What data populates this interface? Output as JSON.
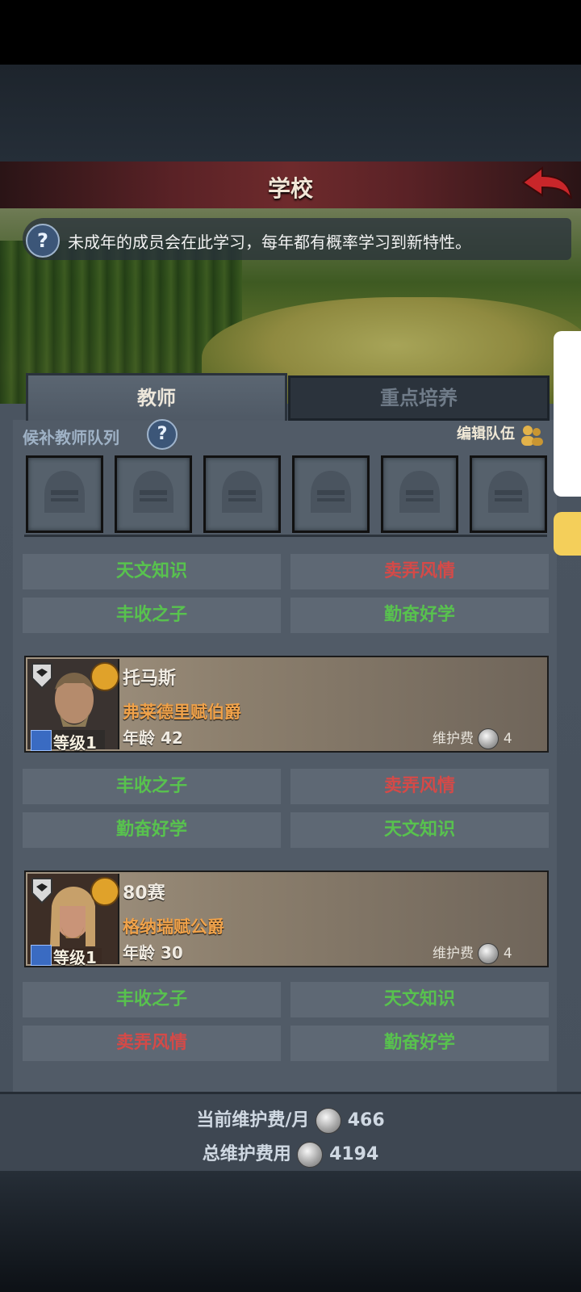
{
  "header": {
    "title": "学校"
  },
  "info": {
    "text": "未成年的成员会在此学习，每年都有概率学习到新特性。"
  },
  "tabs": {
    "teachers": "教师",
    "training": "重点培养"
  },
  "queue": {
    "label": "候补教师队列",
    "edit_team": "编辑队伍",
    "empty_slots": 6
  },
  "queue_traits": [
    {
      "label": "天文知识",
      "tone": "good"
    },
    {
      "label": "卖弄风情",
      "tone": "bad"
    },
    {
      "label": "丰收之子",
      "tone": "good"
    },
    {
      "label": "勤奋好学",
      "tone": "good"
    }
  ],
  "teachers": [
    {
      "name": "托马斯",
      "title": "弗莱德里赋伯爵",
      "age_label": "年龄",
      "age": "42",
      "level": "等级1",
      "upkeep_label": "维护费",
      "upkeep": "4",
      "traits": [
        {
          "label": "丰收之子",
          "tone": "good"
        },
        {
          "label": "卖弄风情",
          "tone": "bad"
        },
        {
          "label": "勤奋好学",
          "tone": "good"
        },
        {
          "label": "天文知识",
          "tone": "good"
        }
      ]
    },
    {
      "name": "80赛",
      "title": "格纳瑞赋公爵",
      "age_label": "年龄",
      "age": "30",
      "level": "等级1",
      "upkeep_label": "维护费",
      "upkeep": "4",
      "traits": [
        {
          "label": "丰收之子",
          "tone": "good"
        },
        {
          "label": "天文知识",
          "tone": "good"
        },
        {
          "label": "卖弄风情",
          "tone": "bad"
        },
        {
          "label": "勤奋好学",
          "tone": "good"
        }
      ]
    }
  ],
  "footer": {
    "monthly_label": "当前维护费/月",
    "monthly_value": "466",
    "total_label": "总维护费用",
    "total_value": "4194"
  },
  "colors": {
    "good": "#58c24e",
    "bad": "#d44a48",
    "header": "#6e2a2c"
  }
}
